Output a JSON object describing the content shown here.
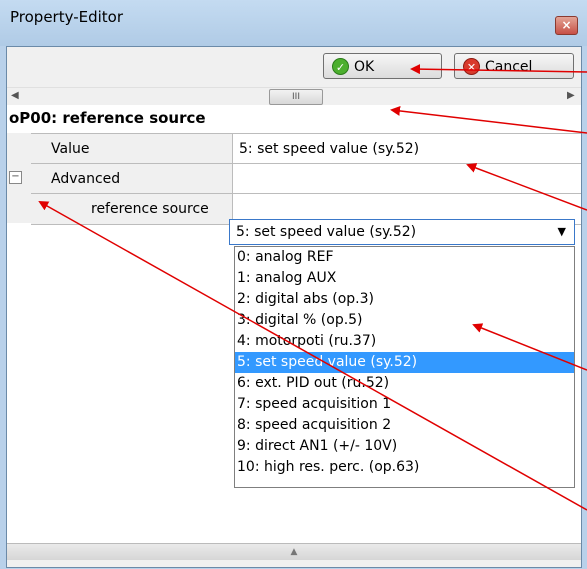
{
  "window": {
    "title": "Property-Editor",
    "close_icon": "close-icon"
  },
  "toolbar": {
    "ok_label": "OK",
    "cancel_label": "Cancel"
  },
  "scrollbar": {
    "thumb_glyph": "III",
    "left_arrow": "◀",
    "right_arrow": "▶"
  },
  "property": {
    "section_title": "oP00: reference source",
    "rows": [
      {
        "label": "Value",
        "value": "5: set speed value (sy.52)"
      },
      {
        "label": "Advanced",
        "value": ""
      },
      {
        "label": "reference source",
        "value": "5: set speed value (sy.52)"
      }
    ]
  },
  "dropdown": {
    "selected": "5: set speed value (sy.52)",
    "options": [
      "0: analog REF",
      "1: analog AUX",
      "2: digital abs (op.3)",
      "3: digital % (op.5)",
      "4: motorpoti (ru.37)",
      "5: set speed value (sy.52)",
      "6: ext. PID out (ru.52)",
      "7: speed acquisition 1",
      "8: speed acquisition 2",
      "9: direct AN1 (+/- 10V)",
      "10: high res. perc. (op.63)"
    ],
    "selected_index": 5
  },
  "expander": {
    "glyph": "−"
  },
  "colors": {
    "annotation_arrow": "#e00000",
    "selection": "#3399ff",
    "select_border": "#3a78c9"
  }
}
